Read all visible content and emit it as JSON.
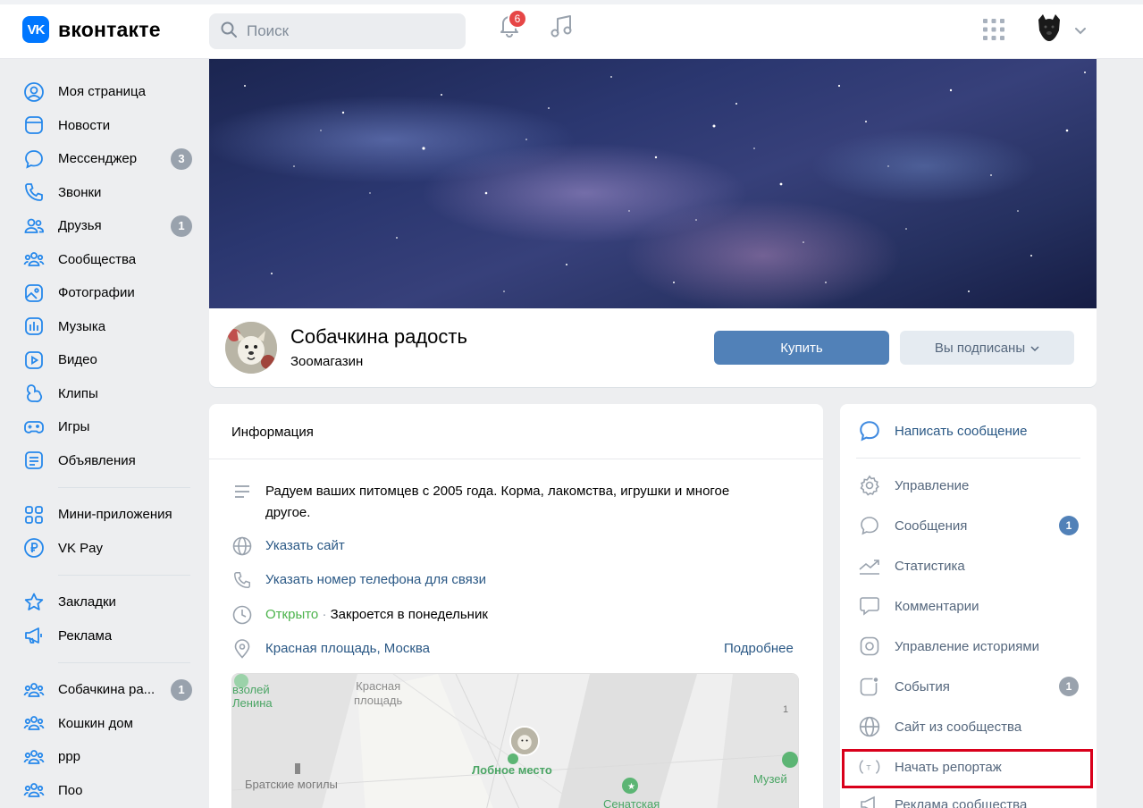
{
  "header": {
    "logo_mark": "VK",
    "logo_text": "вконтакте",
    "search_placeholder": "Поиск",
    "notifications_count": "6"
  },
  "sidebar": {
    "items": [
      {
        "label": "Моя страница",
        "icon": "user-circle-icon"
      },
      {
        "label": "Новости",
        "icon": "news-icon"
      },
      {
        "label": "Мессенджер",
        "icon": "chat-bubble-icon",
        "badge": "3"
      },
      {
        "label": "Звонки",
        "icon": "phone-icon"
      },
      {
        "label": "Друзья",
        "icon": "friends-icon",
        "badge": "1"
      },
      {
        "label": "Сообщества",
        "icon": "communities-icon"
      },
      {
        "label": "Фотографии",
        "icon": "photo-icon"
      },
      {
        "label": "Музыка",
        "icon": "music-icon"
      },
      {
        "label": "Видео",
        "icon": "video-icon"
      },
      {
        "label": "Клипы",
        "icon": "clips-icon"
      },
      {
        "label": "Игры",
        "icon": "gamepad-icon"
      },
      {
        "label": "Объявления",
        "icon": "ads-list-icon"
      },
      {
        "label": "Мини-приложения",
        "icon": "apps-grid-icon"
      },
      {
        "label": "VK Pay",
        "icon": "ruble-icon"
      },
      {
        "label": "Закладки",
        "icon": "star-icon"
      },
      {
        "label": "Реклама",
        "icon": "megaphone-icon"
      },
      {
        "label": "Собачкина ра...",
        "icon": "communities-icon",
        "badge": "1"
      },
      {
        "label": "Кошкин дом",
        "icon": "communities-icon"
      },
      {
        "label": "ррр",
        "icon": "communities-icon"
      },
      {
        "label": "Поо",
        "icon": "communities-icon"
      }
    ]
  },
  "group": {
    "name": "Собачкина радость",
    "category": "Зоомагазин",
    "buy_label": "Купить",
    "subscribed_label": "Вы подписаны"
  },
  "info": {
    "title": "Информация",
    "description": "Радуем ваших питомцев с 2005 года. Корма, лакомства, игрушки и многое другое.",
    "site_link": "Указать сайт",
    "phone_link": "Указать номер телефона для связи",
    "open_status": "Открыто",
    "open_separator": " · ",
    "closes_text": "Закроется в понедельник",
    "address": "Красная площадь, Москва",
    "more_link": "Подробнее",
    "map_labels": {
      "top_left_line1": "взолей",
      "top_left_line2": "Ленина",
      "square_line1": "Красная",
      "square_line2": "площадь",
      "place": "Лобное место",
      "graves": "Братские могилы",
      "museum": "Музей",
      "number": "1",
      "bottom": "Сенатская"
    }
  },
  "actions": {
    "items": [
      {
        "label": "Написать сообщение",
        "icon": "message-bubble-icon"
      },
      {
        "label": "Управление",
        "icon": "gear-icon"
      },
      {
        "label": "Сообщения",
        "icon": "chat-bubble-icon",
        "badge": "1"
      },
      {
        "label": "Статистика",
        "icon": "chart-line-icon"
      },
      {
        "label": "Комментарии",
        "icon": "comment-icon"
      },
      {
        "label": "Управление историями",
        "icon": "story-icon"
      },
      {
        "label": "События",
        "icon": "event-icon",
        "badge": "1"
      },
      {
        "label": "Сайт из сообщества",
        "icon": "globe-icon"
      },
      {
        "label": "Начать репортаж",
        "icon": "broadcast-icon"
      },
      {
        "label": "Реклама сообщества",
        "icon": "megaphone-icon"
      }
    ]
  },
  "colors": {
    "brand": "#0077ff",
    "primary_button": "#5181b8",
    "badge_blue": "#5181b8",
    "badge_grey": "#99a2ad",
    "highlight_red": "#d9001b"
  }
}
